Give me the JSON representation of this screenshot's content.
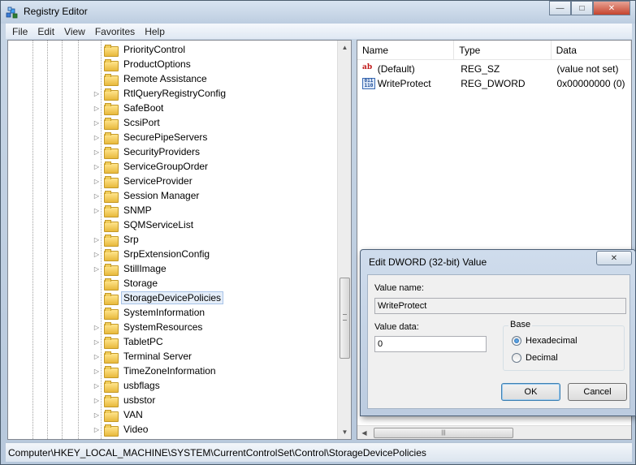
{
  "window": {
    "title": "Registry Editor",
    "controls": {
      "minimize": "—",
      "maximize": "□",
      "close": "✕"
    }
  },
  "menu": [
    "File",
    "Edit",
    "View",
    "Favorites",
    "Help"
  ],
  "tree": {
    "items": [
      {
        "label": "PriorityControl",
        "expandable": false
      },
      {
        "label": "ProductOptions",
        "expandable": false
      },
      {
        "label": "Remote Assistance",
        "expandable": false
      },
      {
        "label": "RtlQueryRegistryConfig",
        "expandable": true
      },
      {
        "label": "SafeBoot",
        "expandable": true
      },
      {
        "label": "ScsiPort",
        "expandable": true
      },
      {
        "label": "SecurePipeServers",
        "expandable": true
      },
      {
        "label": "SecurityProviders",
        "expandable": true
      },
      {
        "label": "ServiceGroupOrder",
        "expandable": true
      },
      {
        "label": "ServiceProvider",
        "expandable": true
      },
      {
        "label": "Session Manager",
        "expandable": true
      },
      {
        "label": "SNMP",
        "expandable": true
      },
      {
        "label": "SQMServiceList",
        "expandable": false
      },
      {
        "label": "Srp",
        "expandable": true
      },
      {
        "label": "SrpExtensionConfig",
        "expandable": true
      },
      {
        "label": "StillImage",
        "expandable": true
      },
      {
        "label": "Storage",
        "expandable": false
      },
      {
        "label": "StorageDevicePolicies",
        "expandable": false,
        "selected": true
      },
      {
        "label": "SystemInformation",
        "expandable": false
      },
      {
        "label": "SystemResources",
        "expandable": true
      },
      {
        "label": "TabletPC",
        "expandable": true
      },
      {
        "label": "Terminal Server",
        "expandable": true
      },
      {
        "label": "TimeZoneInformation",
        "expandable": true
      },
      {
        "label": "usbflags",
        "expandable": true
      },
      {
        "label": "usbstor",
        "expandable": true
      },
      {
        "label": "VAN",
        "expandable": true
      },
      {
        "label": "Video",
        "expandable": true
      }
    ]
  },
  "list": {
    "columns": [
      "Name",
      "Type",
      "Data"
    ],
    "rows": [
      {
        "icon": "string-value-icon",
        "name": "(Default)",
        "type": "REG_SZ",
        "data": "(value not set)"
      },
      {
        "icon": "binary-value-icon",
        "name": "WriteProtect",
        "type": "REG_DWORD",
        "data": "0x00000000 (0)"
      }
    ]
  },
  "status": {
    "path": "Computer\\HKEY_LOCAL_MACHINE\\SYSTEM\\CurrentControlSet\\Control\\StorageDevicePolicies"
  },
  "dialog": {
    "title": "Edit DWORD (32-bit) Value",
    "close_label": "✕",
    "value_name_label": "Value name:",
    "value_name": "WriteProtect",
    "value_data_label": "Value data:",
    "value_data": "0",
    "base_label": "Base",
    "hex_label": "Hexadecimal",
    "dec_label": "Decimal",
    "base_selected": "hexadecimal",
    "ok_label": "OK",
    "cancel_label": "Cancel"
  },
  "colors": {
    "selection_bg": "#e5eef9",
    "titlebar": "#bccde0",
    "close_red": "#c5442d"
  }
}
